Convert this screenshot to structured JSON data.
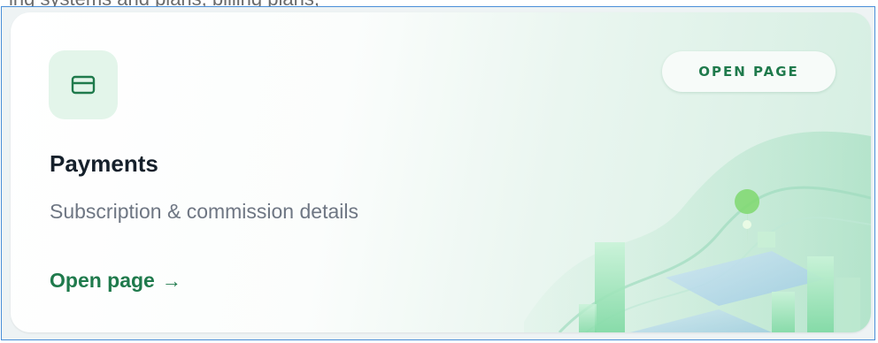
{
  "top_text": "ing systems and plans, billing plans,",
  "card": {
    "icon": "credit-card-icon",
    "badge_label": "OPEN PAGE",
    "title": "Payments",
    "subtitle": "Subscription & commission details",
    "link_label": "Open page",
    "link_arrow": "→"
  },
  "colors": {
    "accent": "#1f7a4c",
    "icon_tile_bg": "#e3f5ea",
    "title": "#15202b",
    "subtitle": "#6e7683"
  }
}
